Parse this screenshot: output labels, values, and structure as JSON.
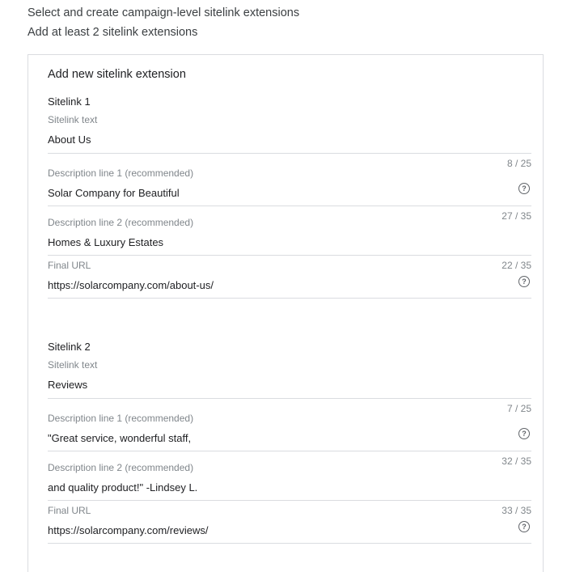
{
  "intro": {
    "line1": "Select and create campaign-level sitelink extensions",
    "line2": "Add at least 2 sitelink extensions"
  },
  "panel": {
    "title": "Add new sitelink extension"
  },
  "sitelinks": [
    {
      "heading": "Sitelink 1",
      "text_label": "Sitelink text",
      "text_value": "About Us",
      "text_counter": "8 / 25",
      "desc1_label": "Description line 1 (recommended)",
      "desc1_value": "Solar Company for Beautiful",
      "desc1_counter": "27 / 35",
      "desc2_label": "Description line 2 (recommended)",
      "desc2_value": "Homes & Luxury Estates",
      "desc2_counter": "22 / 35",
      "url_label": "Final URL",
      "url_value": "https://solarcompany.com/about-us/"
    },
    {
      "heading": "Sitelink 2",
      "text_label": "Sitelink text",
      "text_value": "Reviews",
      "text_counter": "7 / 25",
      "desc1_label": "Description line 1 (recommended)",
      "desc1_value": "\"Great service, wonderful staff,",
      "desc1_counter": "32 / 35",
      "desc2_label": "Description line 2 (recommended)",
      "desc2_value": "and quality product!\" -Lindsey L.",
      "desc2_counter": "33 / 35",
      "url_label": "Final URL",
      "url_value": "https://solarcompany.com/reviews/"
    }
  ],
  "icons": {
    "help": "help-circle-icon",
    "help_glyph": "?"
  }
}
